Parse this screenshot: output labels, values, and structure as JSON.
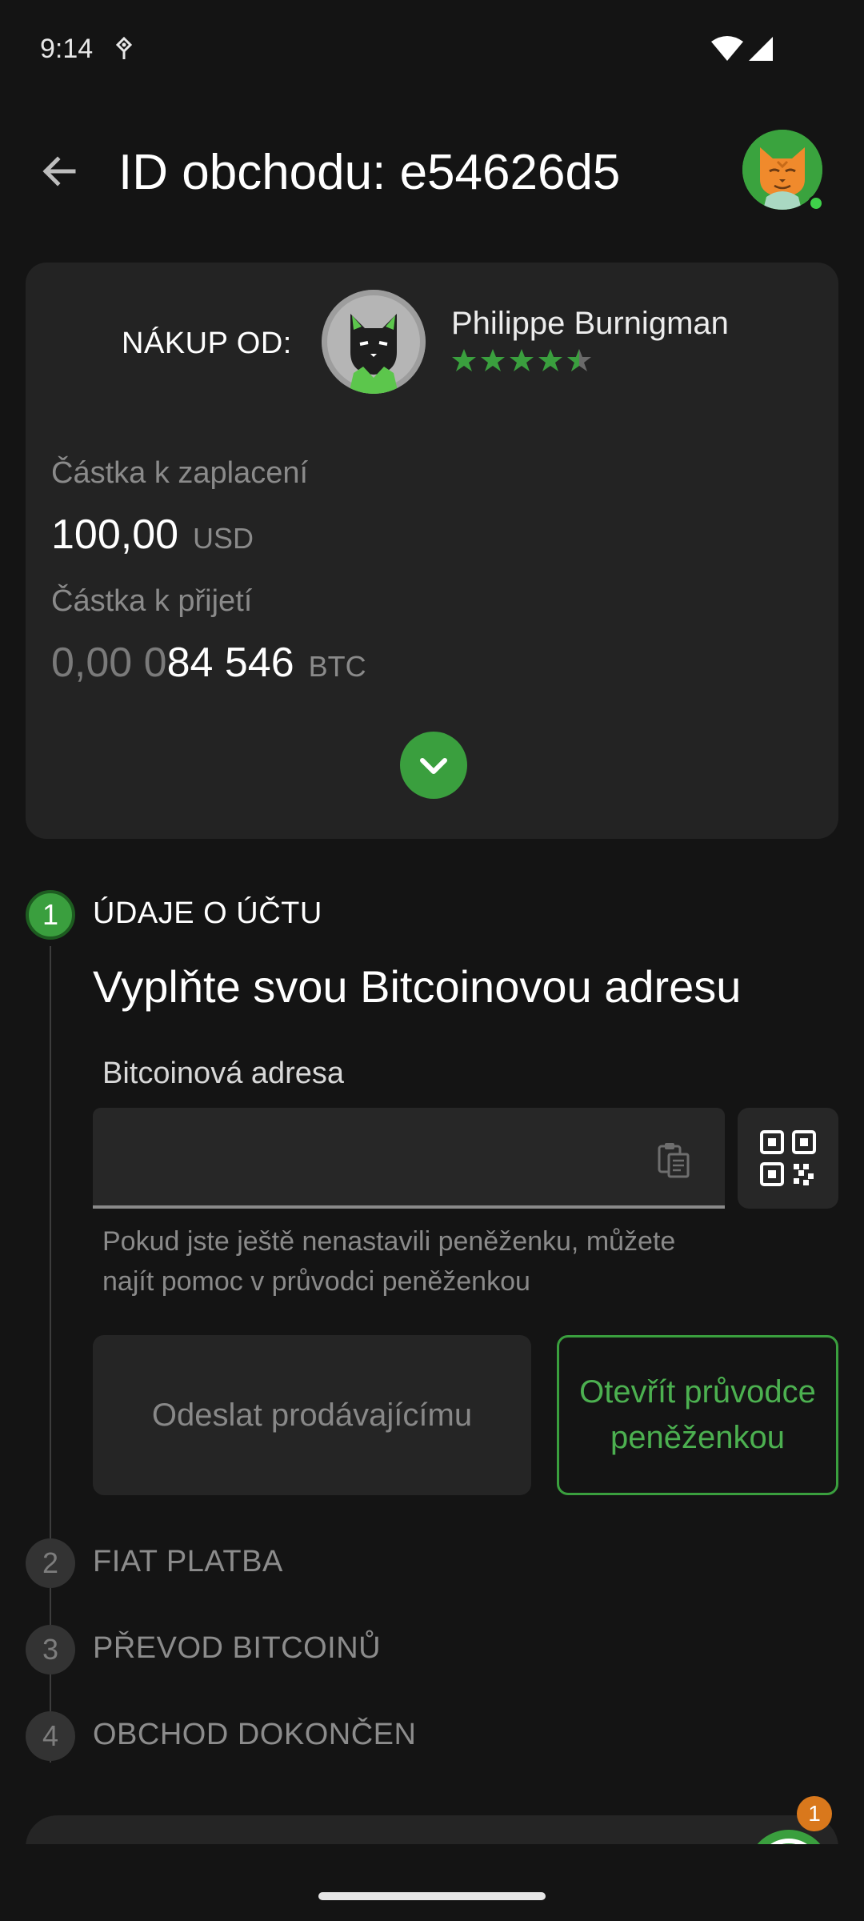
{
  "status_bar": {
    "time": "9:14",
    "icons": [
      "notification-icon",
      "wifi-icon",
      "signal-icon"
    ]
  },
  "header": {
    "title": "ID obchodu: e54626d5",
    "back_icon": "arrow-left-icon",
    "avatar": "cat-avatar",
    "online": true
  },
  "summary": {
    "buy_from_label": "NÁKUP OD:",
    "seller_name": "Philippe Burnigman",
    "rating": 4.5,
    "rating_max": 5,
    "pay_label": "Částka k zaplacení",
    "pay_amount": "100,00",
    "pay_currency": "USD",
    "receive_label": "Částka k přijetí",
    "receive_amount_dim": "0,00 0",
    "receive_amount_bright": "84 546",
    "receive_currency": "BTC",
    "expand_icon": "chevron-down-icon"
  },
  "steps": [
    {
      "number": "1",
      "title": "ÚDAJE O ÚČTU",
      "active": true
    },
    {
      "number": "2",
      "title": "FIAT PLATBA",
      "active": false
    },
    {
      "number": "3",
      "title": "PŘEVOD BITCOINŮ",
      "active": false
    },
    {
      "number": "4",
      "title": "OBCHOD DOKONČEN",
      "active": false
    }
  ],
  "step1": {
    "heading": "Vyplňte svou Bitcoinovou adresu",
    "address_label": "Bitcoinová adresa",
    "address_value": "",
    "address_placeholder": "",
    "helper_text": "Pokud jste ještě nenastavili peněženku, můžete najít pomoc v průvodci peněženkou",
    "send_button": "Odeslat prodávajícímu",
    "guide_button": "Otevřít průvodce peněženkou"
  },
  "chat": {
    "badge_count": "1"
  },
  "colors": {
    "accent": "#3a9f3e",
    "background": "#141414",
    "card": "#232323",
    "badge": "#d9781c"
  }
}
